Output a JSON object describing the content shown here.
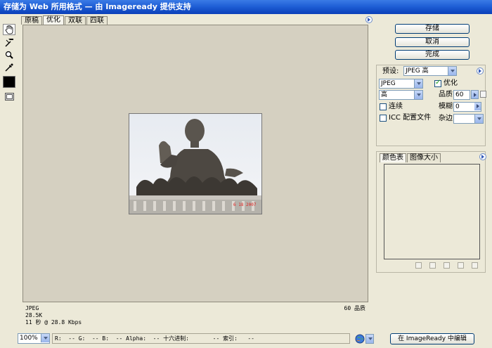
{
  "window": {
    "title": "存储为 Web 所用格式 — 由 Imageready 提供支持"
  },
  "tabs": [
    "原稿",
    "优化",
    "双联",
    "四联"
  ],
  "active_tab": "优化",
  "toolbox": {
    "tools": [
      "hand-tool",
      "slice-select-tool",
      "zoom-tool",
      "eyedropper-tool"
    ],
    "eyedropper_color": "#000000"
  },
  "buttons": {
    "save": "存储",
    "cancel": "取消",
    "done": "完成",
    "edit_in_imageready": "在 ImageReady 中编辑"
  },
  "settings": {
    "preset_label": "预设:",
    "preset_value": "JPEG 高",
    "format_value": "JPEG",
    "quality_level_value": "高",
    "optimized_label": "优化",
    "optimized_checked": true,
    "progressive_label": "连续",
    "progressive_checked": false,
    "icc_label": "ICC 配置文件",
    "icc_checked": false,
    "quality_label": "品质:",
    "quality_value": "60",
    "blur_label": "模糊:",
    "blur_value": "0",
    "matte_label": "杂边:",
    "matte_value": ""
  },
  "color_panel": {
    "tabs": [
      "颜色表",
      "图像大小"
    ],
    "active_tab": "颜色表"
  },
  "preview": {
    "date_stamp": "6 18 2007"
  },
  "optimization_info": {
    "format": "JPEG",
    "size": "28.5K",
    "time": "11 秒 @ 28.8 Kbps",
    "quality": "60 品质"
  },
  "statusbar": {
    "zoom": "100%",
    "pixel_info": "R:  -- G:  -- B:  -- Alpha:  -- 十六进制:       -- 索引:   --"
  }
}
